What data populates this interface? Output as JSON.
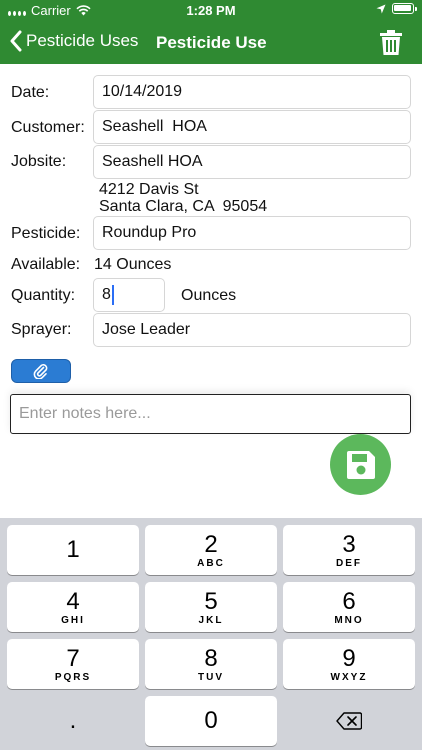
{
  "status_bar": {
    "carrier": "Carrier",
    "time": "1:28 PM"
  },
  "nav": {
    "back_label": "Pesticide Uses",
    "title": "Pesticide Use"
  },
  "form": {
    "date": {
      "label": "Date:",
      "value": "10/14/2019"
    },
    "customer": {
      "label": "Customer:",
      "value": "Seashell  HOA"
    },
    "jobsite": {
      "label": "Jobsite:",
      "value": "Seashell HOA",
      "address_line1": "4212 Davis St",
      "address_line2": "Santa Clara, CA  95054"
    },
    "pesticide": {
      "label": "Pesticide:",
      "value": "Roundup Pro"
    },
    "available": {
      "label": "Available:",
      "value": "14 Ounces"
    },
    "quantity": {
      "label": "Quantity:",
      "value": "8",
      "unit": "Ounces"
    },
    "sprayer": {
      "label": "Sprayer:",
      "value": "Jose Leader"
    },
    "notes": {
      "placeholder": "Enter notes here..."
    }
  },
  "keyboard": {
    "keys": [
      {
        "num": "1",
        "letters": ""
      },
      {
        "num": "2",
        "letters": "ABC"
      },
      {
        "num": "3",
        "letters": "DEF"
      },
      {
        "num": "4",
        "letters": "GHI"
      },
      {
        "num": "5",
        "letters": "JKL"
      },
      {
        "num": "6",
        "letters": "MNO"
      },
      {
        "num": "7",
        "letters": "PQRS"
      },
      {
        "num": "8",
        "letters": "TUV"
      },
      {
        "num": "9",
        "letters": "WXYZ"
      },
      {
        "num": ".",
        "letters": ""
      },
      {
        "num": "0",
        "letters": ""
      }
    ]
  },
  "colors": {
    "nav_green": "#2f8a32",
    "save_green": "#5cb85c",
    "attach_blue": "#2b7cd3"
  },
  "icons": {
    "back": "chevron-left-icon",
    "trash": "trash-icon",
    "attach": "paperclip-icon",
    "save": "floppy-disk-icon",
    "backspace": "backspace-icon"
  }
}
